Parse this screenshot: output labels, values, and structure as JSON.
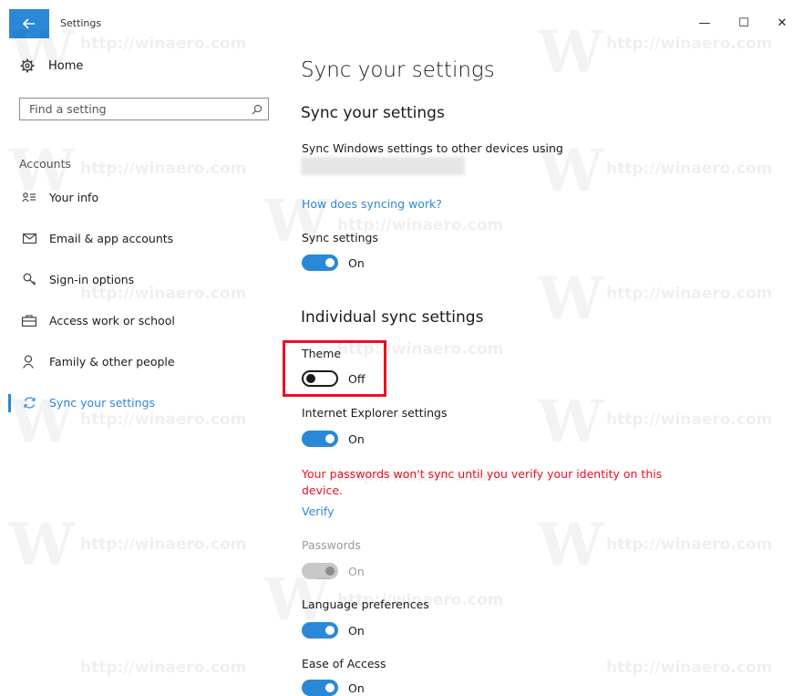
{
  "window": {
    "title": "Settings",
    "controls": {
      "minimize": "—",
      "maximize": "☐",
      "close": "✕"
    }
  },
  "sidebar": {
    "home_label": "Home",
    "search_placeholder": "Find a setting",
    "section": "Accounts",
    "items": [
      {
        "label": "Your info",
        "icon": "person-card-icon"
      },
      {
        "label": "Email & app accounts",
        "icon": "mail-icon"
      },
      {
        "label": "Sign-in options",
        "icon": "key-icon"
      },
      {
        "label": "Access work or school",
        "icon": "briefcase-icon"
      },
      {
        "label": "Family & other people",
        "icon": "person-icon"
      },
      {
        "label": "Sync your settings",
        "icon": "sync-icon",
        "active": true
      }
    ]
  },
  "main": {
    "page_title": "Sync your settings",
    "sub_title": "Sync your settings",
    "description": "Sync Windows settings to other devices using",
    "how_link": "How does syncing work?",
    "sync_settings": {
      "label": "Sync settings",
      "state": "On"
    },
    "individual_title": "Individual sync settings",
    "theme": {
      "label": "Theme",
      "state": "Off"
    },
    "ie": {
      "label": "Internet Explorer settings",
      "state": "On"
    },
    "warning": "Your passwords won't sync until you verify your identity on this device.",
    "verify_link": "Verify",
    "passwords": {
      "label": "Passwords",
      "state": "On"
    },
    "language": {
      "label": "Language preferences",
      "state": "On"
    },
    "ease": {
      "label": "Ease of Access",
      "state": "On"
    }
  },
  "colors": {
    "accent": "#2b88d8",
    "warning": "#e81123",
    "highlight": "#e81123"
  },
  "watermark": {
    "text": "http://winaero.com"
  }
}
